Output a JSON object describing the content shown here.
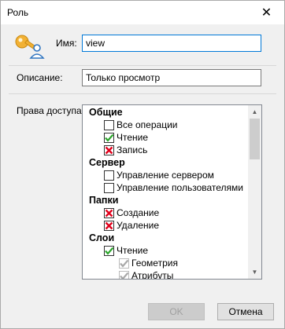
{
  "window": {
    "title": "Роль",
    "close_glyph": "✕"
  },
  "form": {
    "name_label": "Имя:",
    "name_value": "view",
    "description_label": "Описание:",
    "description_value": "Только просмотр",
    "rights_label": "Права доступа:"
  },
  "tree": {
    "groups": {
      "general": {
        "title": "Общие",
        "items": [
          {
            "label": "Все операции",
            "state": "unchecked"
          },
          {
            "label": "Чтение",
            "state": "check"
          },
          {
            "label": "Запись",
            "state": "cross"
          }
        ]
      },
      "server": {
        "title": "Сервер",
        "items": [
          {
            "label": "Управление сервером",
            "state": "unchecked"
          },
          {
            "label": "Управление пользователями",
            "state": "unchecked"
          }
        ]
      },
      "folders": {
        "title": "Папки",
        "items": [
          {
            "label": "Создание",
            "state": "cross"
          },
          {
            "label": "Удаление",
            "state": "cross"
          }
        ]
      },
      "layers": {
        "title": "Слои",
        "items": [
          {
            "label": "Чтение",
            "state": "check"
          }
        ],
        "subitems": [
          {
            "label": "Геометрия",
            "state": "check-disabled"
          },
          {
            "label": "Атрибуты",
            "state": "check-disabled"
          }
        ]
      }
    }
  },
  "buttons": {
    "ok": "OK",
    "cancel": "Отмена"
  },
  "colors": {
    "check": "#2aa52a",
    "cross": "#e0001b",
    "disabled_check": "#a8a8a8",
    "focus": "#0078d7"
  }
}
